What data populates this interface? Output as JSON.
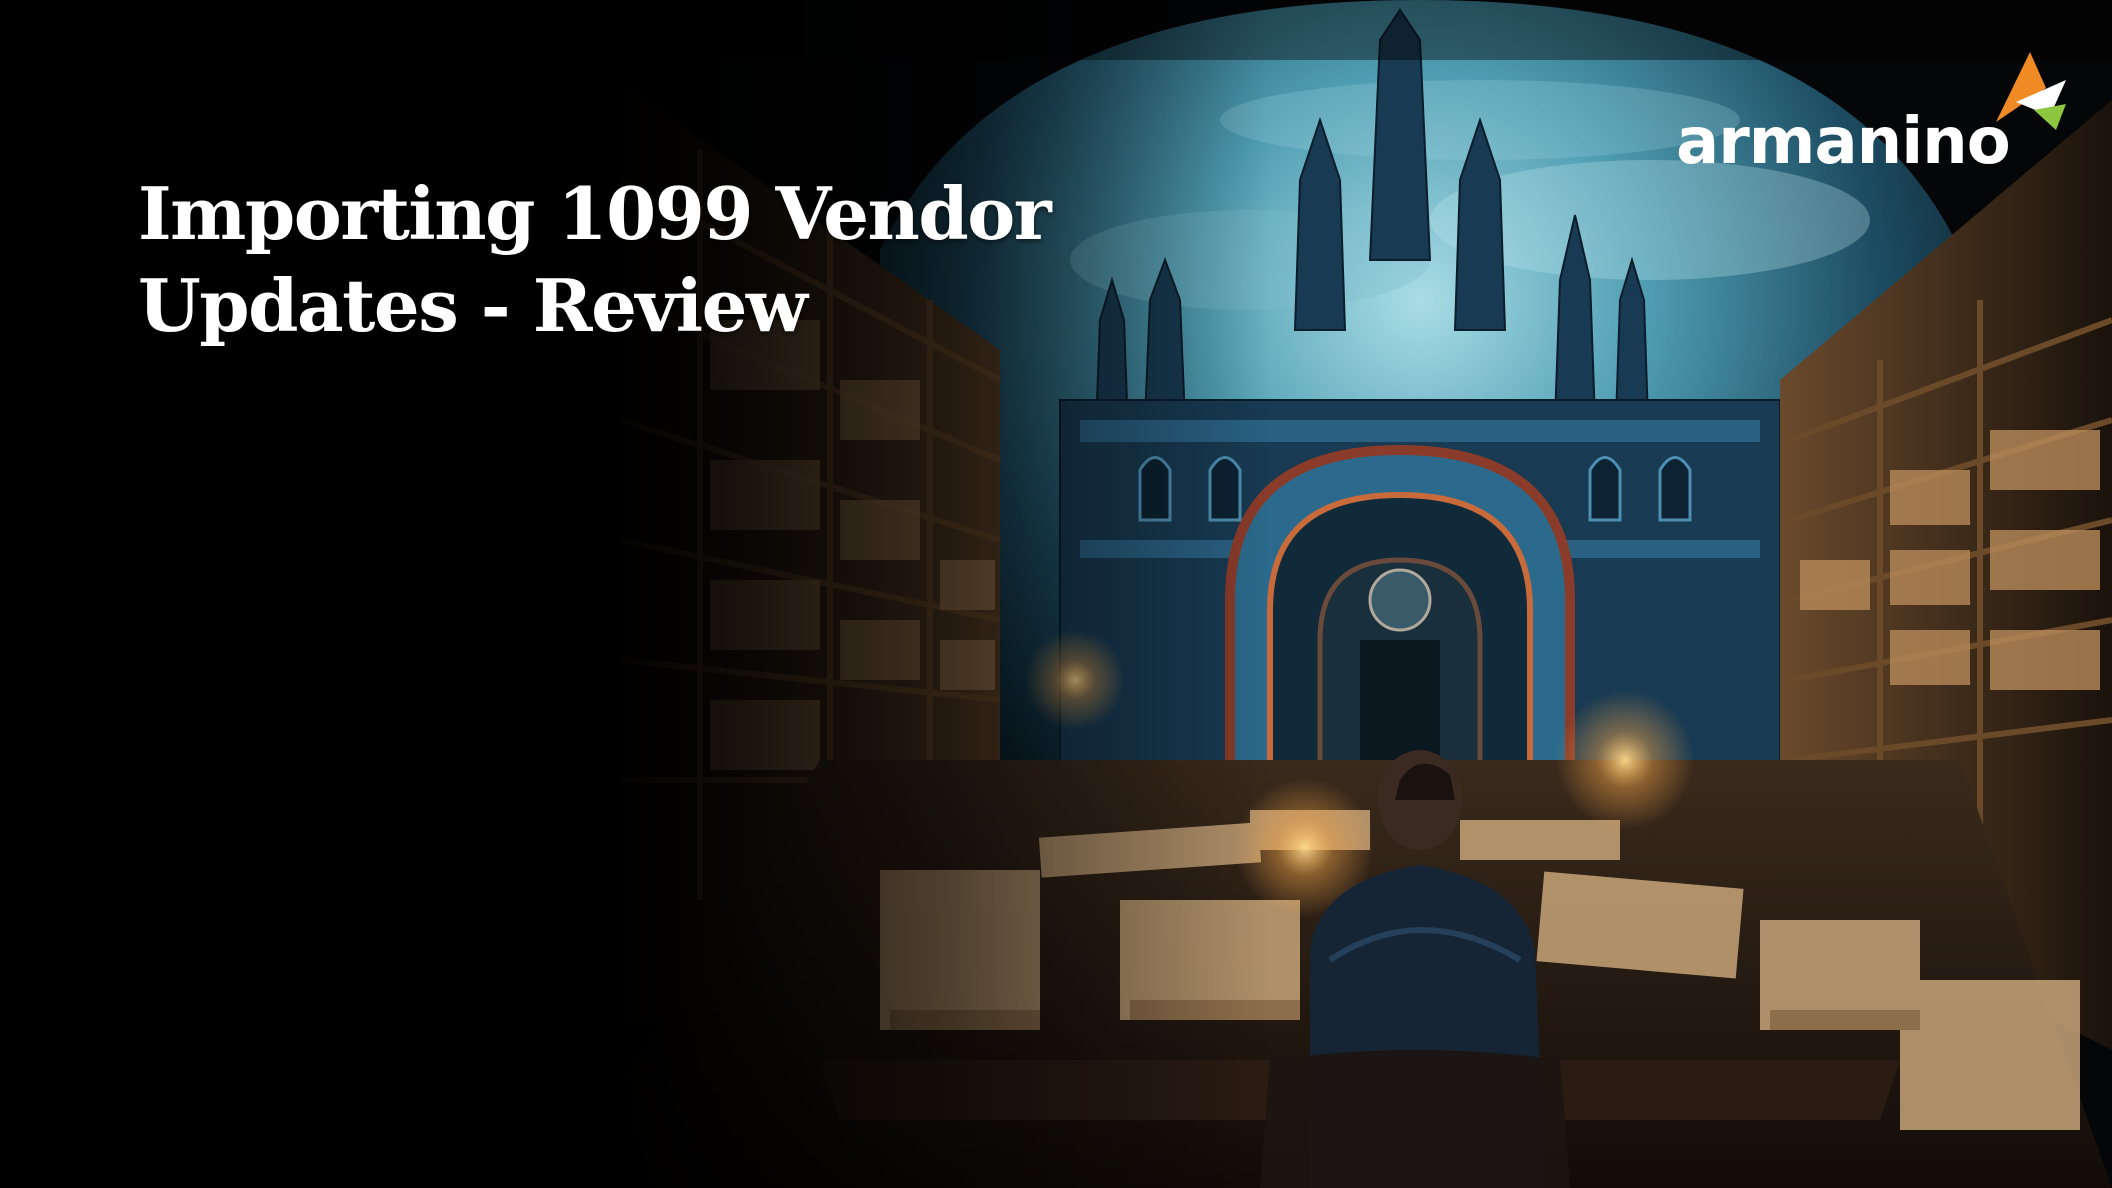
{
  "slide": {
    "title": "Importing 1099 Vendor Updates - Review",
    "background_art": "gothic-library-man-at-desk-illustration"
  },
  "logo": {
    "wordmark": "armanino",
    "mark_icon": "armanino-arrow-mark-icon",
    "mark_colors": [
      "#f08a24",
      "#8dc63f",
      "#ffffff"
    ]
  },
  "colors": {
    "title_text": "#ffffff",
    "background": "#000000",
    "sky": "#3f8fa6",
    "warm_light": "#f3a54a"
  }
}
